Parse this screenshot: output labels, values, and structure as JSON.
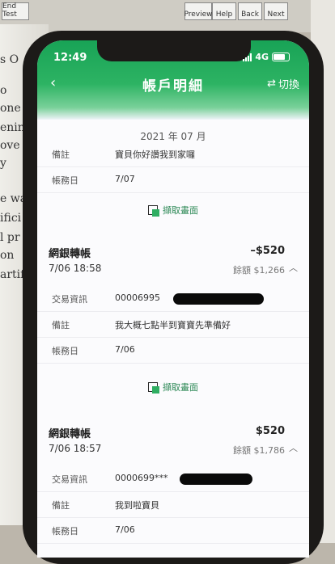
{
  "background": {
    "toolbar": [
      "End Test",
      "Preview",
      "Help",
      "Back",
      "Next"
    ],
    "paper_fragments": [
      "s O",
      "o",
      "one",
      "enin",
      "ove",
      "y",
      "e wa",
      "ifici",
      "l pr",
      "on",
      "artif"
    ]
  },
  "status_bar": {
    "time": "12:49",
    "network": "4G"
  },
  "nav": {
    "back": "‹",
    "title": "帳戶明細",
    "switch_label": "切換"
  },
  "month": "2021 年 07 月",
  "top_rows": [
    {
      "label": "備註",
      "value": "寶貝你好讚我到家囉"
    },
    {
      "label": "帳務日",
      "value": "7/07"
    }
  ],
  "capture_label": "擷取畫面",
  "transactions": [
    {
      "title": "網銀轉帳",
      "amount": "–$520",
      "time": "7/06 18:58",
      "balance": "餘額 $1,266",
      "rows": [
        {
          "label": "交易資訊",
          "value": "00006995"
        },
        {
          "label": "備註",
          "value": "我大概七點半到寶寶先準備好"
        },
        {
          "label": "帳務日",
          "value": "7/06"
        }
      ]
    },
    {
      "title": "網銀轉帳",
      "amount": "$520",
      "time": "7/06 18:57",
      "balance": "餘額 $1,786",
      "rows": [
        {
          "label": "交易資訊",
          "value": "0000699***"
        },
        {
          "label": "備註",
          "value": "我到啦寶貝"
        },
        {
          "label": "帳務日",
          "value": "7/06"
        }
      ]
    }
  ]
}
